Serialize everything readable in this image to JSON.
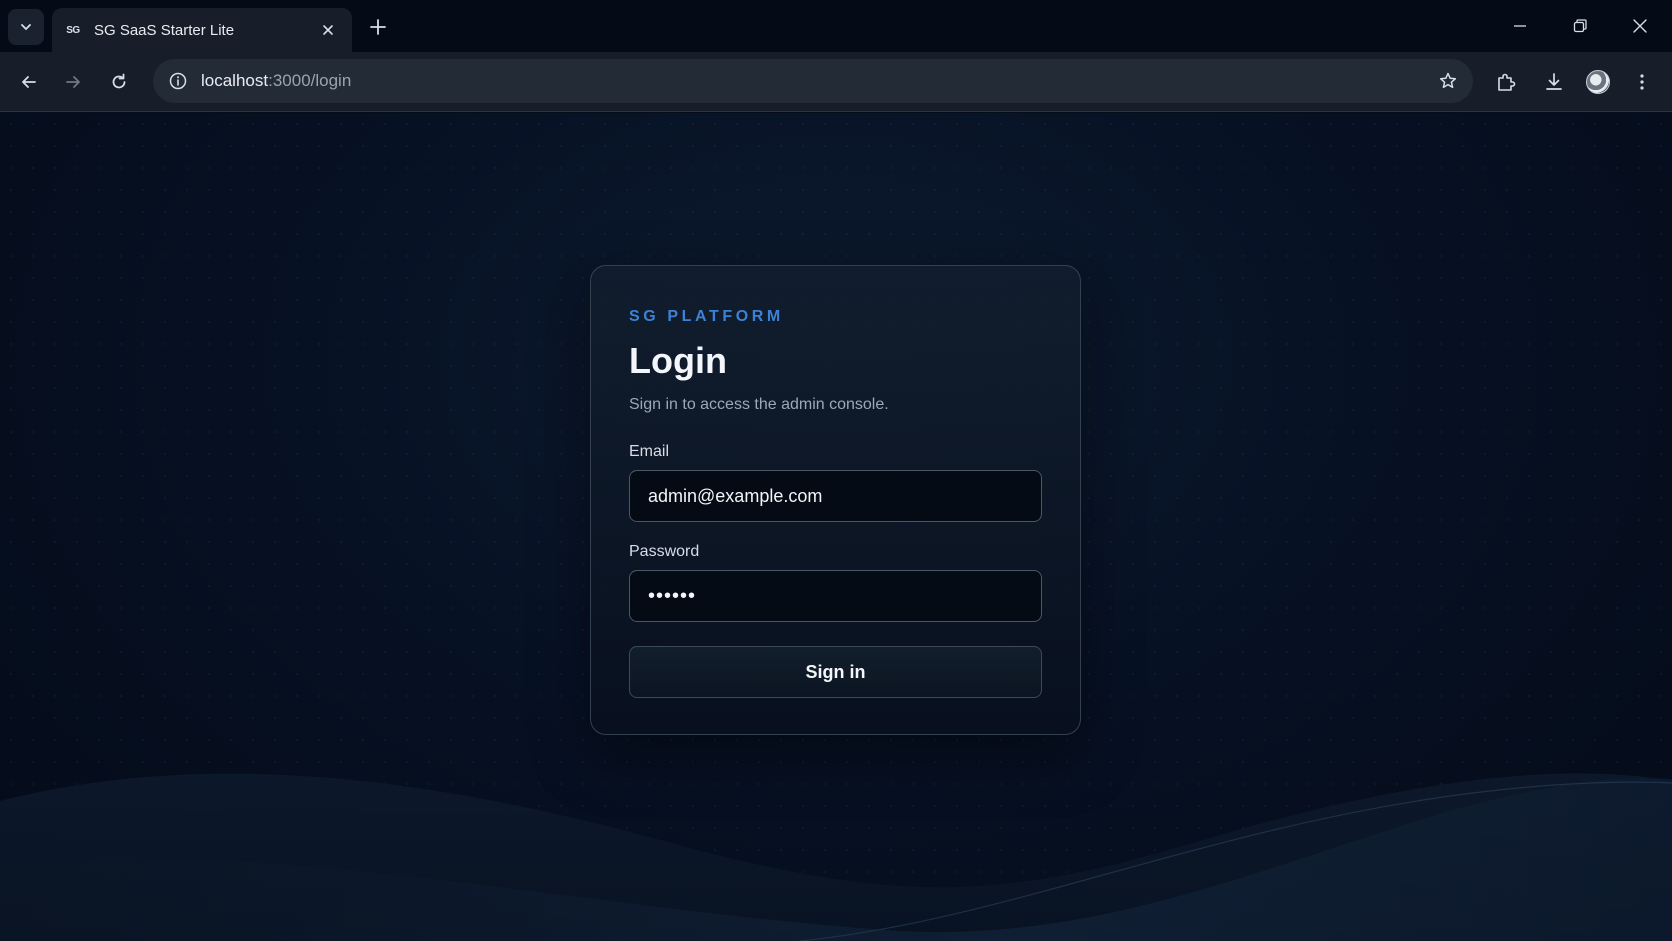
{
  "browser": {
    "tab": {
      "favicon_text": "SG",
      "title": "SG SaaS Starter Lite"
    },
    "url": {
      "host": "localhost",
      "path": ":3000/login"
    },
    "icons": {
      "tab_search": "chevron-down-icon",
      "tab_close": "close-icon",
      "new_tab": "plus-icon",
      "minimize": "minimize-icon",
      "restore": "restore-icon",
      "close_window": "close-icon",
      "back": "arrow-left-icon",
      "forward": "arrow-right-icon",
      "reload": "reload-icon",
      "site_info": "info-icon",
      "bookmark": "star-icon",
      "extensions": "puzzle-icon",
      "downloads": "download-icon",
      "profile": "avatar-icon",
      "menu": "kebab-menu-icon"
    }
  },
  "login": {
    "eyebrow": "SG PLATFORM",
    "title": "Login",
    "subtitle": "Sign in to access the admin console.",
    "email_label": "Email",
    "email_value": "admin@example.com",
    "password_label": "Password",
    "password_value": "••••••",
    "submit_label": "Sign in"
  },
  "colors": {
    "accent": "#3b82d6",
    "background": "#050d1a",
    "card_border": "#33414f"
  }
}
